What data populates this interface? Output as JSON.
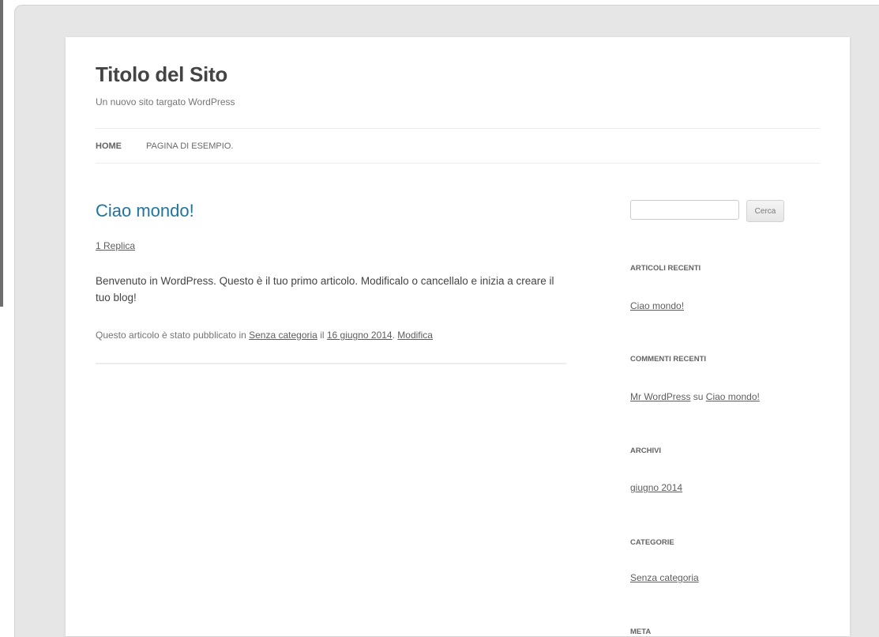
{
  "site": {
    "title": "Titolo del Sito",
    "description": "Un nuovo sito targato WordPress"
  },
  "nav": {
    "items": [
      {
        "label": "HOME",
        "current": true
      },
      {
        "label": "PAGINA DI ESEMPIO."
      }
    ]
  },
  "post": {
    "title": "Ciao mondo!",
    "replies": "1 Replica",
    "body": "Benvenuto in WordPress. Questo è il tuo primo articolo. Modificalo o cancellalo e inizia a creare il tuo blog!",
    "meta": {
      "prefix": "Questo articolo è stato pubblicato in ",
      "category": "Senza categoria",
      "date_prefix": " il ",
      "date": "16 giugno 2014",
      "dot": ". ",
      "edit": "Modifica"
    }
  },
  "sidebar": {
    "search": {
      "value": "",
      "button": "Cerca"
    },
    "recent_posts": {
      "title": "ARTICOLI RECENTI",
      "item": "Ciao mondo!"
    },
    "recent_comments": {
      "title": "COMMENTI RECENTI",
      "author": "Mr WordPress",
      "conj": " su ",
      "post": "Ciao mondo!"
    },
    "archives": {
      "title": "ARCHIVI",
      "item": "giugno 2014"
    },
    "categories": {
      "title": "CATEGORIE",
      "item": "Senza categoria"
    },
    "meta": {
      "title": "META"
    }
  },
  "colors": {
    "backdrop": "#e6e6e6",
    "post_title": "#21759b",
    "text": "#444444"
  }
}
